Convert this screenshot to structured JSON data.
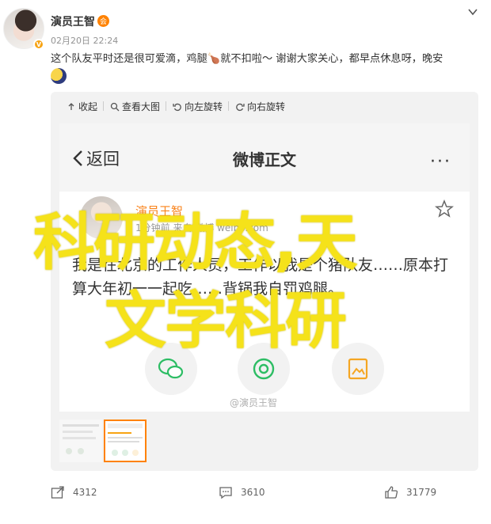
{
  "post": {
    "author": "演员王智",
    "member_badge": "会",
    "verified_badge": "V",
    "time": "02月20日 22:24",
    "text": "这个队友平时还是很可爱滴，鸡腿🍗就不扣啦～ 谢谢大家关心，都早点休息呀，晚安",
    "emoji_icon": "moon-emoji-icon"
  },
  "viewer": {
    "tools": [
      "收起",
      "查看大图",
      "向左旋转",
      "向右旋转"
    ],
    "watermark": "@演员王智",
    "overlay": [
      "科研动态,天",
      "文学科研"
    ]
  },
  "screenshot": {
    "back_label": "返回",
    "title": "微博正文",
    "more": "···",
    "inner_author": "演员王智",
    "inner_time": "1分钟前 来自 微博 weibo.com",
    "inner_text": "我是在北京的工作人员，工作以我是个猪队友……原本打算大年初一一起吃……背锅我自罚鸡腿。"
  },
  "actions": {
    "repost": "4312",
    "comment": "3610",
    "like": "31779"
  },
  "colors": {
    "accent_orange": "#ff8200",
    "overlay_yellow": "#f5e21a"
  }
}
